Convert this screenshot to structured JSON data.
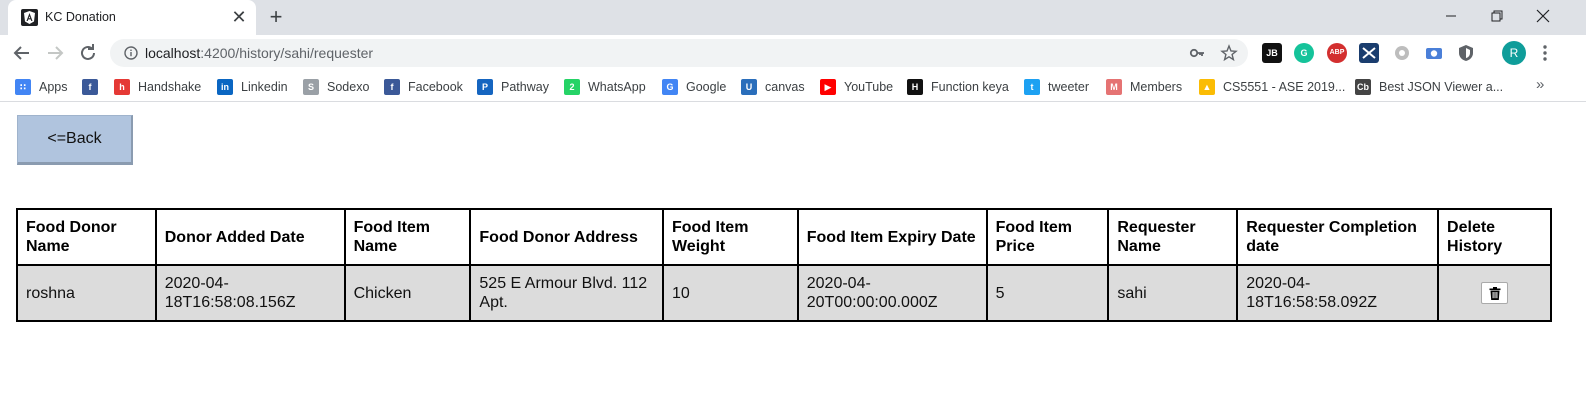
{
  "browser": {
    "tab": {
      "title": "KC Donation"
    },
    "url": {
      "host": "localhost",
      "rest": ":4200/history/sahi/requester"
    },
    "profile_initial": "R",
    "extensions": [
      "JB",
      "G",
      "ABP"
    ]
  },
  "bookmarks": [
    {
      "label": "Apps",
      "icon": "apps-grid-icon",
      "color": "#4285f4"
    },
    {
      "label": "",
      "icon": "facebook-icon",
      "color": "#3b5998"
    },
    {
      "label": "Handshake",
      "icon": "handshake-icon",
      "color": "#e53935"
    },
    {
      "label": "Linkedin",
      "icon": "linkedin-icon",
      "color": "#0a66c2"
    },
    {
      "label": "Sodexo",
      "icon": "sodexo-icon",
      "color": "#9aa0a6"
    },
    {
      "label": "Facebook",
      "icon": "facebook-icon",
      "color": "#3b5998"
    },
    {
      "label": "Pathway",
      "icon": "pathway-icon",
      "color": "#1565c0"
    },
    {
      "label": "WhatsApp",
      "icon": "whatsapp-icon",
      "color": "#25d366"
    },
    {
      "label": "Google",
      "icon": "google-icon",
      "color": "#4285f4"
    },
    {
      "label": "canvas",
      "icon": "umkc-icon",
      "color": "#2a6ebb"
    },
    {
      "label": "YouTube",
      "icon": "youtube-icon",
      "color": "#ff0000"
    },
    {
      "label": "Function keya",
      "icon": "htg-icon",
      "color": "#111111"
    },
    {
      "label": "tweeter",
      "icon": "twitter-icon",
      "color": "#1da1f2"
    },
    {
      "label": "Members",
      "icon": "members-icon",
      "color": "#e57373"
    },
    {
      "label": "CS5551 - ASE 2019...",
      "icon": "google-drive-icon",
      "color": "#fbbc04"
    },
    {
      "label": "Best JSON Viewer a...",
      "icon": "cb-icon",
      "color": "#444444"
    }
  ],
  "page": {
    "back_label": "<=Back",
    "table": {
      "headers": [
        "Food Donor Name",
        "Donor Added Date",
        "Food Item Name",
        "Food Donor Address",
        "Food Item Weight",
        "Food Item Expiry Date",
        "Food Item Price",
        "Requester Name",
        "Requester Completion date",
        "Delete History"
      ],
      "rows": [
        [
          "roshna",
          "2020-04-18T16:58:08.156Z",
          "Chicken",
          "525 E Armour Blvd. 112 Apt.",
          "10",
          "2020-04-20T00:00:00.000Z",
          "5",
          "sahi",
          "2020-04-18T16:58:58.092Z"
        ]
      ]
    }
  },
  "colors": {
    "back_button": "#b0c4de",
    "row_background": "#dcdcdc",
    "tab_strip": "#dee1e6"
  }
}
